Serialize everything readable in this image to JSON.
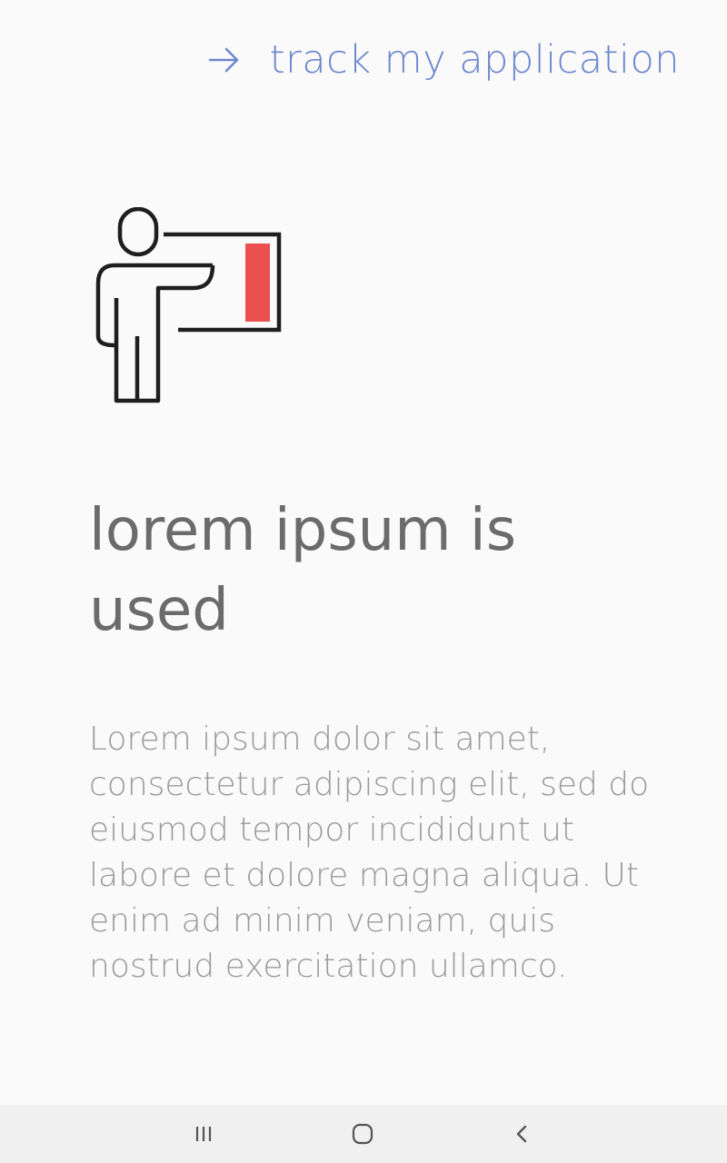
{
  "header": {
    "track_link_label": "track my application",
    "track_link_icon": "arrow-right-icon",
    "accent_color": "#6d87cf"
  },
  "illustration": {
    "icon": "presenter-board-icon",
    "accent_color": "#eb4f4f"
  },
  "content": {
    "headline": "lorem ipsum is used",
    "body": "Lorem ipsum dolor sit amet, consectetur adipiscing elit, sed do eiusmod tempor incididunt ut labore et dolore magna aliqua. Ut enim ad minim veniam, quis nostrud exercitation ullamco."
  },
  "nav_bar": {
    "recents_icon": "recents-icon",
    "home_icon": "home-icon",
    "back_icon": "back-icon"
  }
}
